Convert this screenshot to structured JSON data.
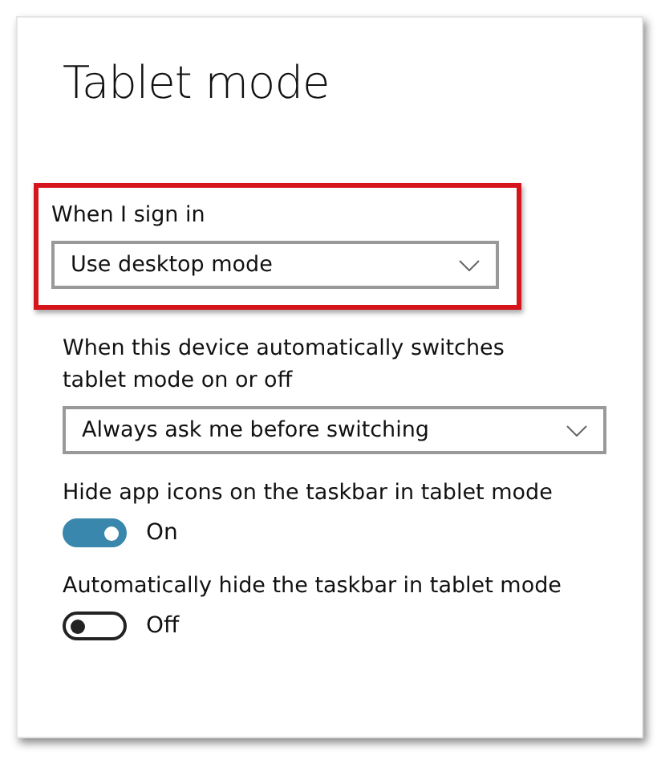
{
  "title": "Tablet mode",
  "settings": [
    {
      "kind": "dropdown",
      "label": "When I sign in",
      "value": "Use desktop mode",
      "highlighted": true
    },
    {
      "kind": "dropdown",
      "label": "When this device automatically switches tablet mode on or off",
      "value": "Always ask me before switching",
      "highlighted": false
    },
    {
      "kind": "toggle",
      "label": "Hide app icons on the taskbar in tablet mode",
      "on": true,
      "state_text": "On"
    },
    {
      "kind": "toggle",
      "label": "Automatically hide the taskbar in tablet mode",
      "on": false,
      "state_text": "Off"
    }
  ]
}
